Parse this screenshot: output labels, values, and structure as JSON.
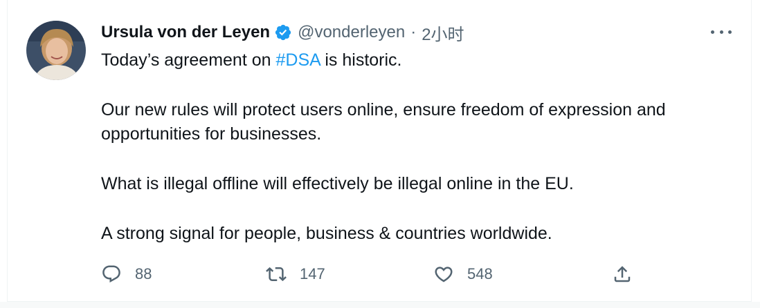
{
  "tweet": {
    "author_name": "Ursula von der Leyen",
    "handle": "@vonderleyen",
    "separator": "·",
    "time": "2小时",
    "text_line1_before": "Today’s agreement on ",
    "hashtag": "#DSA",
    "text_line1_after": " is historic.",
    "paragraph2": "Our new rules will protect users online, ensure freedom of expression and opportunities for businesses.",
    "paragraph3": "What is illegal offline will effectively be illegal online in the EU.",
    "paragraph4": "A strong signal for people, business & countries worldwide."
  },
  "actions": {
    "reply_count": "88",
    "retweet_count": "147",
    "like_count": "548"
  },
  "colors": {
    "text": "#0f1419",
    "secondary": "#536471",
    "accent": "#1d9bf0"
  },
  "icons": [
    "verified-badge-icon",
    "more-icon",
    "reply-icon",
    "retweet-icon",
    "like-icon",
    "share-icon"
  ]
}
